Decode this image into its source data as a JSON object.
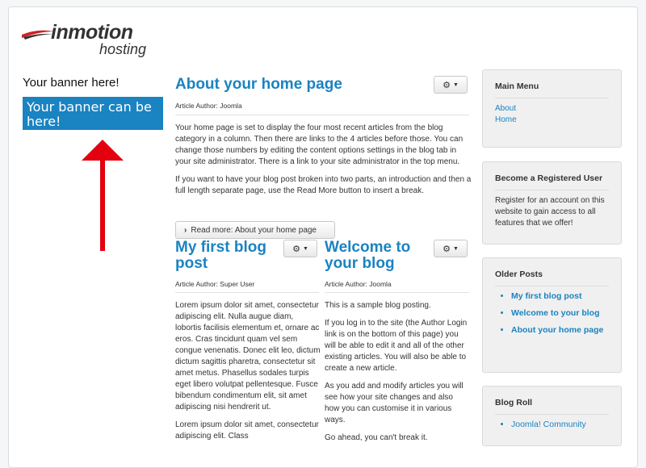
{
  "logo": {
    "word1": "inmotion",
    "word2": "hosting"
  },
  "banner": {
    "heading": "Your banner here!",
    "box_text": "Your banner can be here!"
  },
  "articles": {
    "home": {
      "title": "About your home page",
      "author": "Article Author: Joomla",
      "paragraphs": [
        "Your home page is set to display the four most recent articles from the blog category in a column. Then there are links to the 4 articles before those. You can change those numbers by editing the content options settings in the blog tab in your site administrator. There is a link to your site administrator in the top menu.",
        "If you want to have your blog post broken into two parts, an introduction and then a full length separate page, use the Read More button to insert a break."
      ],
      "readmore": "Read more: About your home page"
    },
    "first": {
      "title_line1": "My first blog",
      "title_line2": "post",
      "author": "Article Author: Super User",
      "paragraphs": [
        "Lorem ipsum dolor sit amet, consectetur adipiscing elit. Nulla augue diam, lobortis facilisis elementum et, ornare ac eros. Cras tincidunt quam vel sem congue venenatis. Donec elit leo, dictum dictum sagittis pharetra, consectetur sit amet metus. Phasellus sodales turpis eget libero volutpat pellentesque. Fusce bibendum condimentum elit, sit amet adipiscing nisi hendrerit ut.",
        "Lorem ipsum dolor sit amet, consectetur adipiscing elit. Class"
      ]
    },
    "welcome": {
      "title_line1": "Welcome to",
      "title_line2": "your blog",
      "author": "Article Author: Joomla",
      "paragraphs": [
        "This is a sample blog posting.",
        "If you log in to the site (the Author Login link is on the bottom of this page) you will be able to edit it and all of the other existing articles. You will also be able to create a new article.",
        "As you add and modify articles you will see how your site changes and also how you can customise it in various ways.",
        "Go ahead, you can't break it."
      ]
    }
  },
  "sidebar": {
    "main_menu": {
      "title": "Main Menu",
      "links": [
        "About",
        "Home"
      ]
    },
    "register": {
      "title": "Become a Registered User",
      "text": "Register for an account on this website to gain access to all features that we offer!"
    },
    "older_posts": {
      "title": "Older Posts",
      "items": [
        "My first blog post",
        "Welcome to your blog",
        "About your home page"
      ]
    },
    "blog_roll": {
      "title": "Blog Roll",
      "items": [
        "Joomla! Community"
      ]
    }
  },
  "colors": {
    "accent": "#1a83c2",
    "arrow": "#e3000f"
  },
  "icons": {
    "gear": "gear-icon",
    "chevron": "chevron-right-icon"
  }
}
